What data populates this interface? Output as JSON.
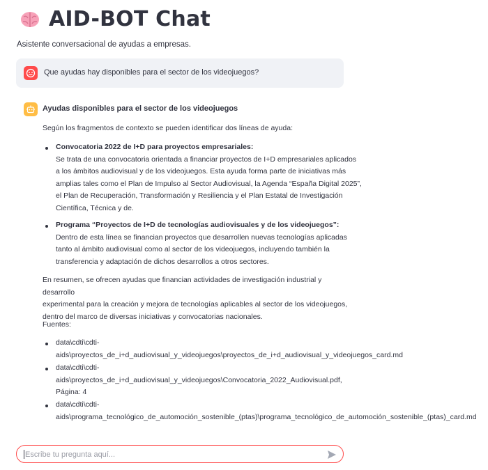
{
  "app": {
    "title": "AID-BOT Chat",
    "title_icon": "brain-icon",
    "subtitle": "Asistente conversacional de ayudas a empresas."
  },
  "colors": {
    "user_avatar": "#ff4b4b",
    "bot_avatar": "#ffbd45",
    "input_border": "#ff4b4b",
    "user_bubble": "#f0f2f6"
  },
  "user_message": {
    "avatar_icon": "user-face-icon",
    "text": "Que ayudas hay disponibles para el sector de los videojuegos?"
  },
  "bot_message": {
    "avatar_icon": "robot-icon",
    "heading": "Ayudas disponibles para el sector de los videojuegos",
    "intro": "Según los fragmentos de contexto se pueden identificar dos líneas de ayuda:",
    "items": [
      {
        "title": "Convocatoria 2022 de I+D para proyectos empresariales:",
        "lines": [
          "Se trata de una convocatoria orientada a financiar proyectos de I+D empresariales aplicados",
          "a los ámbitos audiovisual y de los videojuegos. Esta ayuda forma parte de iniciativas más",
          "amplias tales como el Plan de Impulso al Sector Audiovisual, la Agenda “España Digital 2025”,",
          "el Plan de Recuperación, Transformación y Resiliencia y el Plan Estatal de Investigación",
          "Científica, Técnica y de."
        ]
      },
      {
        "title": "Programa “Proyectos de I+D de tecnologías audiovisuales y de los videojuegos”:",
        "lines": [
          "Dentro de esta línea se financian proyectos que desarrollen nuevas tecnologías aplicadas",
          "tanto al ámbito audiovisual como al sector de los videojuegos, incluyendo también la",
          "transferencia y adaptación de dichos desarrollos a otros sectores."
        ]
      }
    ],
    "summary_lines": [
      "En resumen, se ofrecen ayudas que financian actividades de investigación industrial y desarrollo",
      "experimental para la creación y mejora de tecnologías aplicables al sector de los videojuegos,",
      "dentro del marco de diversas iniciativas y convocatorias nacionales."
    ],
    "sources_label": "Fuentes:",
    "sources": [
      [
        "data\\cdti\\cdti-",
        "aids\\proyectos_de_i+d_audiovisual_y_videojuegos\\proyectos_de_i+d_audiovisual_y_videojuegos_card.md"
      ],
      [
        "data\\cdti\\cdti-",
        "aids\\proyectos_de_i+d_audiovisual_y_videojuegos\\Convocatoria_2022_Audiovisual.pdf,",
        "Página: 4"
      ],
      [
        "data\\cdti\\cdti-",
        "aids\\programa_tecnológico_de_automoción_sostenible_(ptas)\\programa_tecnológico_de_automoción_sostenible_(ptas)_card.md"
      ]
    ]
  },
  "chat_input": {
    "placeholder": "Escribe tu pregunta aquí...",
    "value": "",
    "send_icon": "send-icon"
  }
}
